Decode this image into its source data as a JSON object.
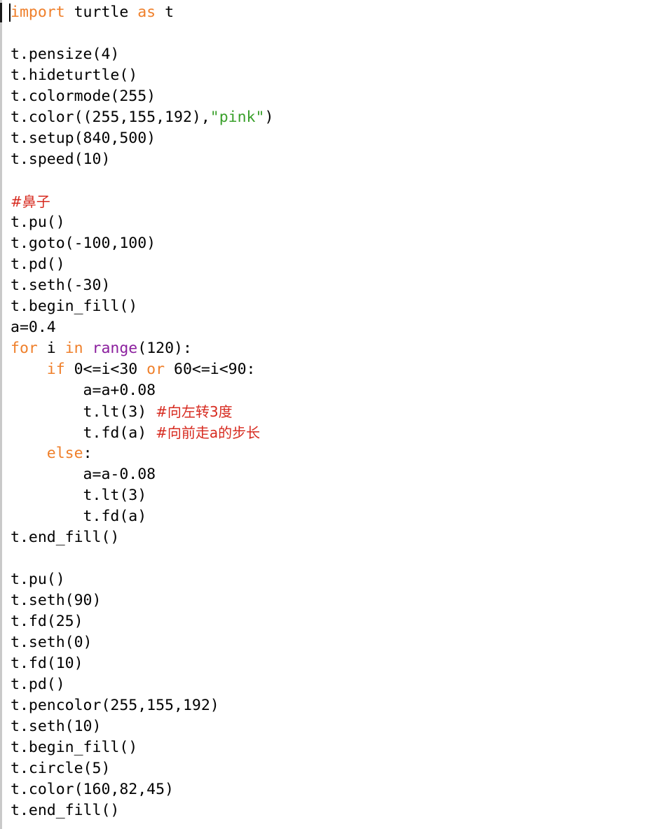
{
  "editor": {
    "colors": {
      "keyword": "#ef7f2a",
      "builtin": "#8b1f9e",
      "string": "#3aa02b",
      "comment": "#d72a1f",
      "text": "#000000"
    },
    "lines": [
      [
        {
          "t": "import",
          "c": "kw"
        },
        {
          "t": " turtle "
        },
        {
          "t": "as",
          "c": "kw"
        },
        {
          "t": " t"
        }
      ],
      [],
      [
        {
          "t": "t.pensize(4)"
        }
      ],
      [
        {
          "t": "t.hideturtle()"
        }
      ],
      [
        {
          "t": "t.colormode(255)"
        }
      ],
      [
        {
          "t": "t.color((255,155,192),"
        },
        {
          "t": "\"pink\"",
          "c": "str"
        },
        {
          "t": ")"
        }
      ],
      [
        {
          "t": "t.setup(840,500)"
        }
      ],
      [
        {
          "t": "t.speed(10)"
        }
      ],
      [],
      [
        {
          "t": "#鼻子",
          "c": "cm"
        }
      ],
      [
        {
          "t": "t.pu()"
        }
      ],
      [
        {
          "t": "t.goto(-100,100)"
        }
      ],
      [
        {
          "t": "t.pd()"
        }
      ],
      [
        {
          "t": "t.seth(-30)"
        }
      ],
      [
        {
          "t": "t.begin_fill()"
        }
      ],
      [
        {
          "t": "a=0.4"
        }
      ],
      [
        {
          "t": "for",
          "c": "kw"
        },
        {
          "t": " i "
        },
        {
          "t": "in",
          "c": "kw"
        },
        {
          "t": " "
        },
        {
          "t": "range",
          "c": "bi"
        },
        {
          "t": "(120):"
        }
      ],
      [
        {
          "t": "    "
        },
        {
          "t": "if",
          "c": "kw"
        },
        {
          "t": " 0<=i<30 "
        },
        {
          "t": "or",
          "c": "kw"
        },
        {
          "t": " 60<=i<90:"
        }
      ],
      [
        {
          "t": "        a=a+0.08"
        }
      ],
      [
        {
          "t": "        t.lt(3) "
        },
        {
          "t": "#向左转3度",
          "c": "cm"
        }
      ],
      [
        {
          "t": "        t.fd(a) "
        },
        {
          "t": "#向前走a的步长",
          "c": "cm"
        }
      ],
      [
        {
          "t": "    "
        },
        {
          "t": "else",
          "c": "kw"
        },
        {
          "t": ":"
        }
      ],
      [
        {
          "t": "        a=a-0.08"
        }
      ],
      [
        {
          "t": "        t.lt(3)"
        }
      ],
      [
        {
          "t": "        t.fd(a)"
        }
      ],
      [
        {
          "t": "t.end_fill()"
        }
      ],
      [],
      [
        {
          "t": "t.pu()"
        }
      ],
      [
        {
          "t": "t.seth(90)"
        }
      ],
      [
        {
          "t": "t.fd(25)"
        }
      ],
      [
        {
          "t": "t.seth(0)"
        }
      ],
      [
        {
          "t": "t.fd(10)"
        }
      ],
      [
        {
          "t": "t.pd()"
        }
      ],
      [
        {
          "t": "t.pencolor(255,155,192)"
        }
      ],
      [
        {
          "t": "t.seth(10)"
        }
      ],
      [
        {
          "t": "t.begin_fill()"
        }
      ],
      [
        {
          "t": "t.circle(5)"
        }
      ],
      [
        {
          "t": "t.color(160,82,45)"
        }
      ],
      [
        {
          "t": "t.end_fill()"
        }
      ]
    ]
  }
}
